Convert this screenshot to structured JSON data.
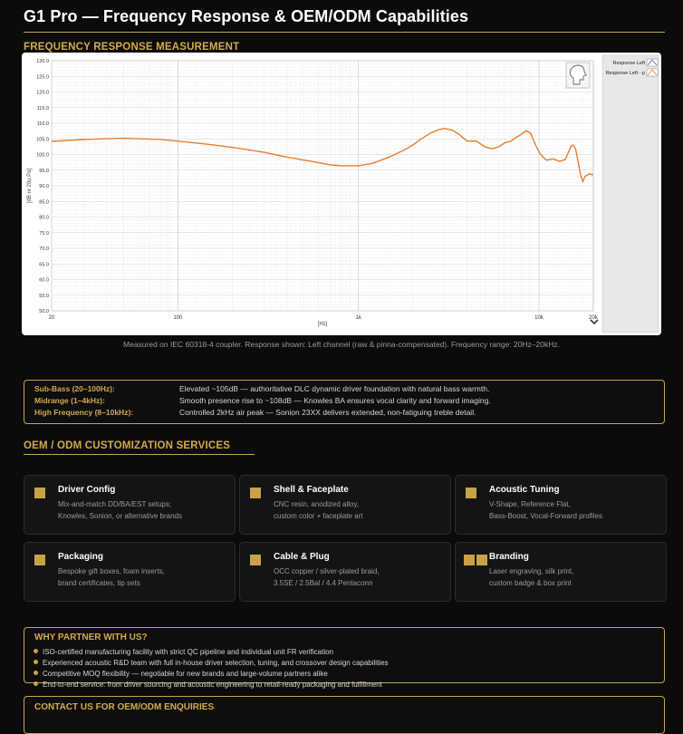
{
  "page": {
    "title": "G1 Pro — Frequency Response & OEM/ODM Capabilities",
    "accent": "#c9a248",
    "background": "#0b0b0b"
  },
  "fr_section": {
    "heading": "FREQUENCY RESPONSE MEASUREMENT",
    "caption": "Measured on IEC 60318-4 coupler. Response shown: Left channel (raw & pinna-compensated). Frequency range: 20Hz–20kHz."
  },
  "chart_data": {
    "type": "line",
    "xscale": "log",
    "xlim": [
      20,
      20000
    ],
    "ylim": [
      50,
      130
    ],
    "xlabel": "[Hz]",
    "ylabel": "[dB re 20u Pa]",
    "x_tick_labels": [
      "20",
      "100",
      "1k",
      "10k",
      "20k"
    ],
    "x_ticks": [
      20,
      100,
      1000,
      10000,
      20000
    ],
    "y_ticks": [
      50,
      55,
      60,
      65,
      70,
      75,
      80,
      85,
      90,
      95,
      100,
      105,
      110,
      115,
      120,
      125,
      130
    ],
    "y_tick_labels": [
      "50.0",
      "55.0",
      "60.0",
      "65.0",
      "70.0",
      "75.0",
      "80.0",
      "85.0",
      "90.0",
      "95.0",
      "100.0",
      "105.0",
      "110.0",
      "115.0",
      "120.0",
      "125.0",
      "130.0"
    ],
    "grid": true,
    "legend_position": "right",
    "legend": [
      "Response Left",
      "Response Left - p"
    ],
    "series": [
      {
        "name": "Response Left",
        "color": "#ea7d2e",
        "x": [
          20,
          30,
          50,
          80,
          100,
          150,
          200,
          300,
          400,
          500,
          600,
          700,
          800,
          1000,
          1200,
          1500,
          1800,
          2000,
          2200,
          2500,
          2800,
          3000,
          3300,
          3600,
          4000,
          4500,
          5000,
          5500,
          6000,
          6500,
          7000,
          7500,
          8000,
          8500,
          9000,
          9500,
          10000,
          10500,
          11000,
          12000,
          13000,
          14000,
          15000,
          15500,
          16000,
          16500,
          17000,
          17500,
          18000,
          19000,
          20000
        ],
        "y": [
          104.2,
          104.8,
          105.2,
          104.8,
          104.3,
          103.2,
          102.3,
          100.7,
          99.2,
          98.2,
          97.4,
          96.7,
          96.4,
          96.4,
          97.2,
          99.3,
          101.5,
          103.0,
          104.8,
          106.8,
          108.0,
          108.3,
          107.8,
          106.5,
          104.3,
          104.3,
          102.5,
          101.8,
          102.5,
          103.8,
          104.3,
          105.5,
          106.5,
          107.6,
          106.8,
          103.5,
          100.8,
          99.2,
          98.2,
          98.6,
          97.8,
          98.4,
          102.5,
          103.0,
          101.5,
          97.5,
          93.5,
          91.3,
          93.0,
          93.8,
          93.5
        ]
      }
    ]
  },
  "frequency_bands": [
    {
      "label": "Sub-Bass (20–100Hz):",
      "desc": "Elevated ~105dB — authoritative DLC dynamic driver foundation with natural bass warmth."
    },
    {
      "label": "Midrange (1–4kHz):",
      "desc": "Smooth presence rise to ~108dB — Knowles BA ensures vocal clarity and forward imaging."
    },
    {
      "label": "High Frequency (8–10kHz):",
      "desc": "Controlled 2kHz air peak — Sonion 23XX delivers extended, non-fatiguing treble detail."
    }
  ],
  "oem_section": {
    "heading": "OEM / ODM CUSTOMIZATION SERVICES",
    "cards": [
      {
        "title": "Driver Config",
        "line1": "Mix-and-match DD/BA/EST setups;",
        "line2": "Knowles, Sonion, or alternative brands"
      },
      {
        "title": "Shell & Faceplate",
        "line1": "CNC resin, anodized alloy,",
        "line2": "custom color + faceplate art"
      },
      {
        "title": "Acoustic Tuning",
        "line1": "V-Shape, Reference Flat,",
        "line2": "Bass-Boost, Vocal-Forward profiles"
      },
      {
        "title": "Packaging",
        "line1": "Bespoke gift boxes, foam inserts,",
        "line2": "brand certificates, tip sets"
      },
      {
        "title": "Cable & Plug",
        "line1": "OCC copper / silver-plated braid,",
        "line2": "3.5SE / 2.5Bal / 4.4 Pentaconn"
      },
      {
        "title": "Branding",
        "line1": "Laser engraving, silk print,",
        "line2": "custom badge & box print"
      }
    ]
  },
  "why_section": {
    "heading": "WHY PARTNER WITH US?",
    "items": [
      "ISO-certified manufacturing facility with strict QC pipeline and individual unit FR verification",
      "Experienced acoustic R&D team with full in-house driver selection, tuning, and crossover design capabilities",
      "Competitive MOQ flexibility — negotiable for new brands and large-volume partners alike",
      "End-to-end service: from driver sourcing and acoustic engineering to retail-ready packaging and fulfillment"
    ]
  },
  "contact_section": {
    "heading": "CONTACT US FOR OEM/ODM ENQUIRIES"
  }
}
